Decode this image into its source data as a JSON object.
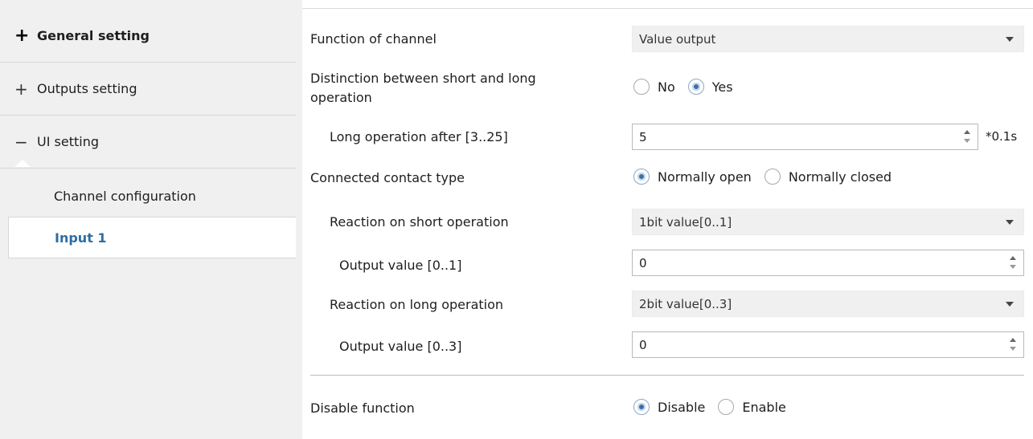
{
  "sidebar": {
    "items": [
      {
        "icon": "+",
        "label": "General setting"
      },
      {
        "icon": "+",
        "label": "Outputs setting"
      },
      {
        "icon": "−",
        "label": "UI setting"
      }
    ],
    "sub_items": [
      {
        "label": "Channel configuration"
      },
      {
        "label": "Input 1"
      }
    ]
  },
  "form": {
    "function_of_channel": {
      "label": "Function of channel",
      "value": "Value output"
    },
    "distinction": {
      "label_line1": "Distinction between short and long",
      "label_line2": "operation",
      "options": [
        "No",
        "Yes"
      ],
      "selected": "Yes"
    },
    "long_operation_after": {
      "label": "Long operation after [3..25]",
      "value": "5",
      "unit": "*0.1s"
    },
    "connected_contact_type": {
      "label": "Connected contact type",
      "options": [
        "Normally open",
        "Normally closed"
      ],
      "selected": "Normally open"
    },
    "reaction_short": {
      "label": "Reaction on short operation",
      "value": "1bit value[0..1]"
    },
    "output_value_short": {
      "label": "Output value [0..1]",
      "value": "0"
    },
    "reaction_long": {
      "label": "Reaction on long operation",
      "value": "2bit value[0..3]"
    },
    "output_value_long": {
      "label": "Output value [0..3]",
      "value": "0"
    },
    "disable_function": {
      "label": "Disable function",
      "options": [
        "Disable",
        "Enable"
      ],
      "selected": "Disable"
    }
  },
  "colors": {
    "accent": "#2e6da4",
    "sidebar_bg": "#f0f0f0",
    "radio_dot": "#3d6fa8"
  }
}
